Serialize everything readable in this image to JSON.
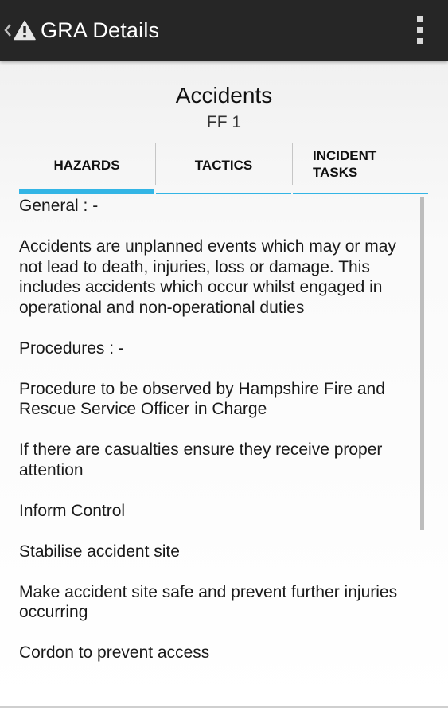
{
  "action_bar": {
    "title": "GRA Details",
    "up_icon": "chevron-left-icon",
    "app_icon": "warning-triangle-icon",
    "overflow_icon": "overflow-menu-icon"
  },
  "header": {
    "title": "Accidents",
    "subtitle": "FF 1"
  },
  "tabs": [
    {
      "label_line1": "HAZARDS",
      "label_line2": "",
      "selected": true
    },
    {
      "label_line1": "TACTICS",
      "label_line2": "",
      "selected": false
    },
    {
      "label_line1": "INCIDENT",
      "label_line2": "TASKS",
      "selected": false
    }
  ],
  "content": {
    "paragraphs": [
      "General : -",
      "Accidents are unplanned events which may or may not lead to death, injuries, loss or damage. This includes accidents which occur whilst engaged in operational and non-operational duties",
      "Procedures : -",
      "Procedure to be observed by Hampshire Fire and Rescue Service Officer in Charge",
      "If there are casualties ensure they receive proper attention",
      "Inform Control",
      "Stabilise accident site",
      "Make accident site safe and prevent further injuries occurring",
      "Cordon to prevent access"
    ]
  },
  "colors": {
    "action_bar": "#262626",
    "tab_indicator": "#33b5e5",
    "text": "#1a1a1a"
  }
}
